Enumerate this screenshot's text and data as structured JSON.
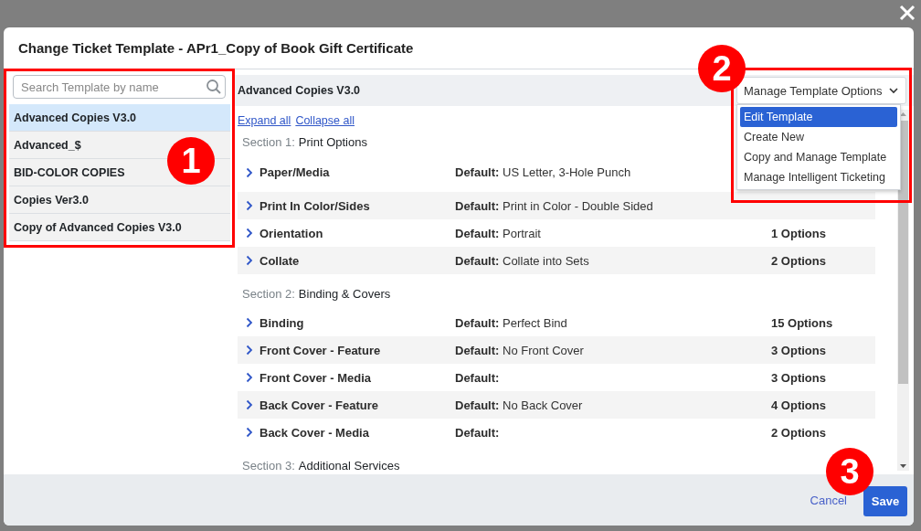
{
  "window": {
    "title": "Change Ticket Template - APr1_Copy of Book Gift Certificate"
  },
  "sidebar": {
    "search": {
      "placeholder": "Search Template by name"
    },
    "items": [
      {
        "label": "Advanced Copies V3.0",
        "selected": true
      },
      {
        "label": "Advanced_$",
        "selected": false
      },
      {
        "label": "BID-COLOR COPIES",
        "selected": false
      },
      {
        "label": "Copies Ver3.0",
        "selected": false
      },
      {
        "label": "Copy of Advanced Copies V3.0",
        "selected": false
      }
    ]
  },
  "template": {
    "title": "Advanced Copies V3.0",
    "manage_button": "Manage Template Options",
    "menu": [
      {
        "label": "Edit Template",
        "selected": true
      },
      {
        "label": "Create New",
        "selected": false
      },
      {
        "label": "Copy and Manage Template",
        "selected": false
      },
      {
        "label": "Manage Intelligent Ticketing",
        "selected": false
      }
    ],
    "links": [
      "Expand all",
      "Collapse all"
    ],
    "sections": [
      {
        "label": "Section 1:",
        "title": "Print Options",
        "rows": [
          {
            "name": "Paper/Media",
            "default_label": "Default:",
            "default": "US Letter, 3-Hole Punch"
          },
          {
            "name": "Print In Color/Sides",
            "default_label": "Default:",
            "default": "Print in Color - Double Sided"
          },
          {
            "name": "Orientation",
            "default_label": "Default:",
            "default": "Portrait",
            "options": "1 Options"
          },
          {
            "name": "Collate",
            "default_label": "Default:",
            "default": "Collate into Sets",
            "options": "2 Options"
          }
        ]
      },
      {
        "label": "Section 2:",
        "title": "Binding & Covers",
        "rows": [
          {
            "name": "Binding",
            "default_label": "Default:",
            "default": "Perfect Bind",
            "options": "15 Options"
          },
          {
            "name": "Front Cover - Feature",
            "default_label": "Default:",
            "default": "No Front Cover",
            "options": "3 Options"
          },
          {
            "name": "Front Cover - Media",
            "default_label": "Default:",
            "options": "3 Options"
          },
          {
            "name": "Back Cover - Feature",
            "default_label": "Default:",
            "default": "No Back Cover",
            "options": "4 Options"
          },
          {
            "name": "Back Cover - Media",
            "default_label": "Default:",
            "options": "2 Options"
          }
        ]
      },
      {
        "label": "Section 3:",
        "title": "Additional Services"
      }
    ]
  },
  "footer": {
    "cancel": "Cancel",
    "save": "Save"
  },
  "annotations": [
    "1",
    "2",
    "3"
  ]
}
